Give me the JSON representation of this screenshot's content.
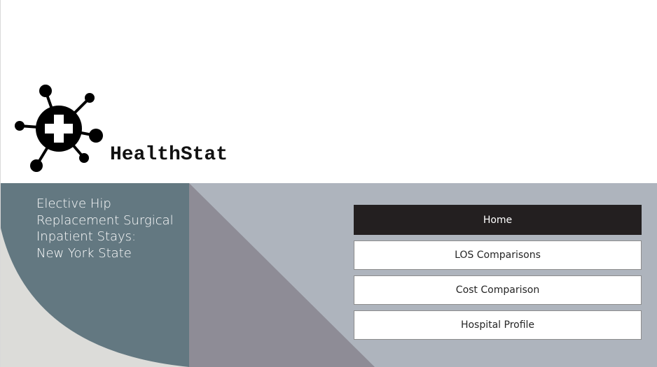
{
  "brand": {
    "name": "HealthStat"
  },
  "report": {
    "title_lines": [
      "Elective Hip",
      "Replacement Surgical",
      "Inpatient Stays:",
      "New York State"
    ]
  },
  "nav": {
    "items": [
      {
        "label": "Home",
        "active": true
      },
      {
        "label": "LOS Comparisons",
        "active": false
      },
      {
        "label": "Cost Comparison",
        "active": false
      },
      {
        "label": "Hospital Profile",
        "active": false
      }
    ]
  },
  "colors": {
    "banner_background": "#aeb4bd",
    "circle_panel": "#637881",
    "diagonal_shape": "#8e8c96",
    "bottom_left": "#dcdcd9",
    "active_nav": "#231f20"
  }
}
